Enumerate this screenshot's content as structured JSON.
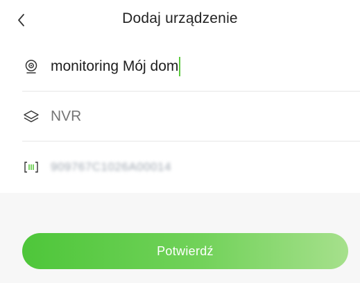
{
  "header": {
    "title": "Dodaj urządzenie",
    "back_icon": "chevron-left-icon"
  },
  "form": {
    "device_name": {
      "icon": "camera-icon",
      "value": "monitoring Mój dom",
      "caret_color": "#5cc93e"
    },
    "device_type": {
      "icon": "layers-icon",
      "placeholder": "NVR"
    },
    "serial": {
      "icon": "barcode-icon",
      "value": "909767C1026A00014"
    }
  },
  "actions": {
    "confirm_label": "Potwierdź"
  },
  "colors": {
    "accent": "#5cc93e",
    "button_gradient_start": "#4ec63a",
    "button_gradient_end": "#a6e08c"
  }
}
